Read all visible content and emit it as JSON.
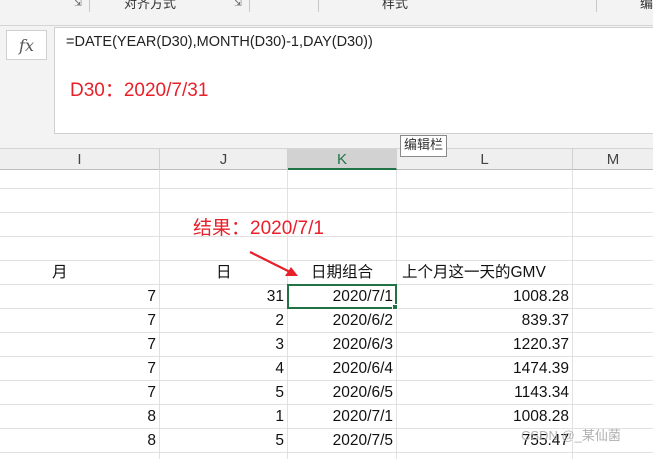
{
  "ribbon": {
    "groups": [
      "对齐方式",
      "样式",
      "编"
    ]
  },
  "formula_bar": {
    "fx_label": "fx",
    "formula": "=DATE(YEAR(D30),MONTH(D30)-1,DAY(D30))",
    "annotation": "D30：2020/7/31",
    "tooltip": "编辑栏"
  },
  "columns": [
    {
      "letter": "I",
      "selected": false
    },
    {
      "letter": "J",
      "selected": false
    },
    {
      "letter": "K",
      "selected": true
    },
    {
      "letter": "L",
      "selected": false
    },
    {
      "letter": "M",
      "selected": false
    }
  ],
  "annotation_result": "结果：2020/7/1",
  "headers": {
    "month": "月",
    "day": "日",
    "date": "日期组合",
    "gmv": "上个月这一天的GMV"
  },
  "rows": [
    {
      "month": "7",
      "day": "31",
      "date": "2020/7/1",
      "gmv": "1008.28"
    },
    {
      "month": "7",
      "day": "2",
      "date": "2020/6/2",
      "gmv": "839.37"
    },
    {
      "month": "7",
      "day": "3",
      "date": "2020/6/3",
      "gmv": "1220.37"
    },
    {
      "month": "7",
      "day": "4",
      "date": "2020/6/4",
      "gmv": "1474.39"
    },
    {
      "month": "7",
      "day": "5",
      "date": "2020/6/5",
      "gmv": "1143.34"
    },
    {
      "month": "8",
      "day": "1",
      "date": "2020/7/1",
      "gmv": "1008.28"
    },
    {
      "month": "8",
      "day": "5",
      "date": "2020/7/5",
      "gmv": "755.47"
    }
  ],
  "watermark": "CSDN @_某仙菌",
  "colors": {
    "accent": "#217346",
    "annotation": "#e8202a"
  }
}
